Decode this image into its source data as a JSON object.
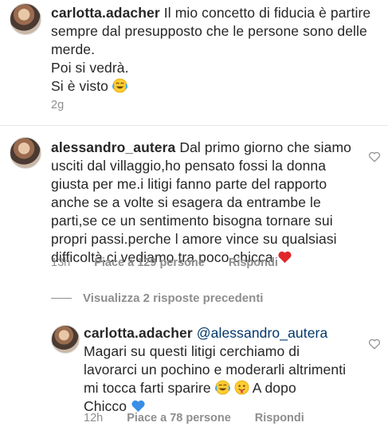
{
  "comments": [
    {
      "username": "carlotta.adacher",
      "lines": [
        "Il mio concetto di fiducia è partire",
        "sempre dal presupposto che le persone sono delle",
        "merde.",
        "Poi si vedrà.",
        "Si è visto"
      ],
      "time": "2g"
    },
    {
      "username": "alessandro_autera",
      "lines": [
        "Dal primo giorno che siamo",
        "usciti dal villaggio,ho pensato fossi la donna",
        "giusta per me.i litigi fanno parte del rapporto",
        "anche se a volte si esagera da entrambe le",
        "parti,se ce un sentimento bisogna tornare sui",
        "propri passi.perche l amore vince su qualsiasi",
        "difficoltà.ci vediamo tra poco chicca"
      ],
      "time": "13h",
      "likes": "Piace a 129 persone",
      "reply": "Rispondi"
    }
  ],
  "view_replies": "Visualizza 2 risposte precedenti",
  "reply_comment": {
    "username": "carlotta.adacher",
    "mention": "@alessandro_autera",
    "lines": [
      "Magari su questi litigi cerchiamo di",
      "lavorarci un pochino e moderarli altrimenti",
      "mi tocca farti sparire",
      "A dopo",
      "Chicco"
    ],
    "time": "12h",
    "likes": "Piace a 78 persone",
    "reply": "Rispondi"
  },
  "icons": {
    "like": "heart-outline-icon",
    "laugh": "face-with-tears-of-joy-icon",
    "tongue": "face-with-tongue-icon",
    "red_heart": "red-heart-icon",
    "blue_heart": "blue-heart-icon"
  },
  "colors": {
    "muted": "#8e8e8e",
    "text": "#262626",
    "red_heart": "#e0272b",
    "blue_heart": "#3a8ee6"
  }
}
